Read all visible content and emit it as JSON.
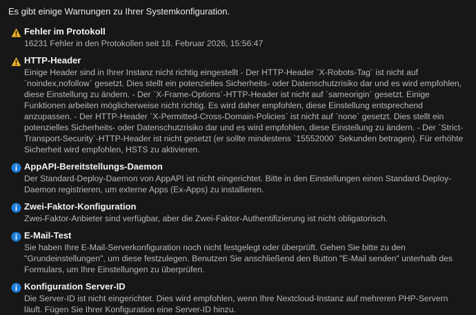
{
  "intro": "Es gibt einige Warnungen zu Ihrer Systemkonfiguration.",
  "colors": {
    "warning": "#f0b429",
    "info": "#1c7ed6",
    "background": "#171717"
  },
  "items": [
    {
      "type": "warning",
      "icon": "warning-icon",
      "title": "Fehler im Protokoll",
      "description": "16231 Fehler in den Protokollen seit 18. Februar 2026, 15:56:47"
    },
    {
      "type": "warning",
      "icon": "warning-icon",
      "title": "HTTP-Header",
      "description": "Einige Header sind in Ihrer Instanz nicht richtig eingestellt - Der HTTP-Header `X-Robots-Tag` ist nicht auf `noindex,nofollow` gesetzt. Dies stellt ein potenzielles Sicherheits- oder Datenschutzrisiko dar und es wird empfohlen, diese Einstellung zu ändern. - Der `X-Frame-Options`-HTTP-Header ist nicht auf `sameorigin` gesetzt. Einige Funktionen arbeiten möglicherweise nicht richtig. Es wird daher empfohlen, diese Einstellung entsprechend anzupassen. - Der HTTP-Header `X-Permitted-Cross-Domain-Policies` ist nicht auf `none` gesetzt. Dies stellt ein potenzielles Sicherheits- oder Datenschutzrisiko dar und es wird empfohlen, diese Einstellung zu ändern. - Der `Strict-Transport-Security`-HTTP-Header ist nicht gesetzt (er sollte mindestens `15552000` Sekunden betragen). Für erhöhte Sicherheit wird empfohlen, HSTS zu aktivieren."
    },
    {
      "type": "info",
      "icon": "info-icon",
      "title": "AppAPI-Bereitstellungs-Daemon",
      "description": "Der Standard-Deploy-Daemon von AppAPI ist nicht eingerichtet. Bitte in den Einstellungen einen Standard-Deploy-Daemon registrieren, um externe Apps (Ex-Apps) zu installieren."
    },
    {
      "type": "info",
      "icon": "info-icon",
      "title": "Zwei-Faktor-Konfiguration",
      "description": "Zwei-Faktor-Anbieter sind verfügbar, aber die Zwei-Faktor-Authentifizierung ist nicht obligatorisch."
    },
    {
      "type": "info",
      "icon": "info-icon",
      "title": "E-Mail-Test",
      "description": "Sie haben Ihre E-Mail-Serverkonfiguration noch nicht festgelegt oder überprüft. Gehen Sie bitte zu den \"Grundeinstellungen\", um diese festzulegen. Benutzen Sie anschließend den Button \"E-Mail senden\" unterhalb des Formulars, um Ihre Einstellungen zu überprüfen."
    },
    {
      "type": "info",
      "icon": "info-icon",
      "title": "Konfiguration Server-ID",
      "description": "Die Server-ID ist nicht eingerichtet. Dies wird empfohlen, wenn Ihre Nextcloud-Instanz auf mehreren PHP-Servern läuft. Fügen Sie Ihrer Konfiguration eine Server-ID hinzu."
    }
  ]
}
